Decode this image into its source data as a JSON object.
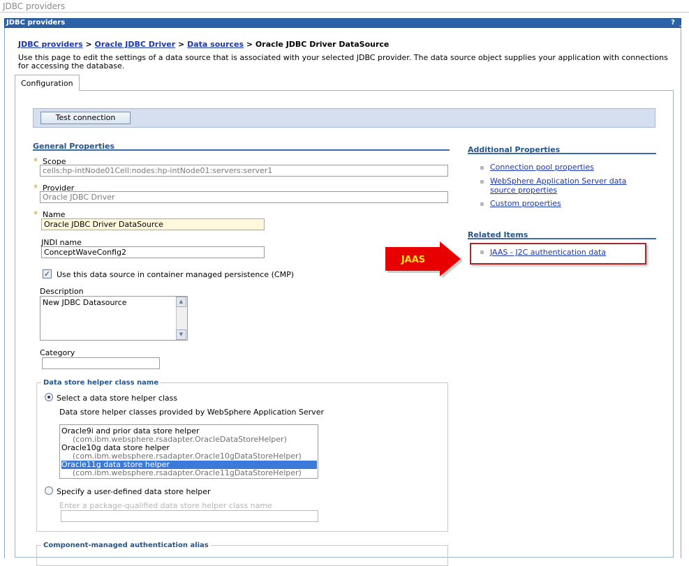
{
  "page": {
    "top_title": "JDBC providers",
    "portlet_title": "JDBC providers",
    "help_button": "?",
    "minimize_button": "_"
  },
  "breadcrumb": {
    "link1": "JDBC providers",
    "sep1": " > ",
    "link2": "Oracle JDBC Driver",
    "sep2": " > ",
    "link3": "Data sources",
    "sep3": " > ",
    "current": "Oracle JDBC Driver DataSource"
  },
  "description": "Use this page to edit the settings of a data source that is associated with your selected JDBC provider. The data source object supplies your application with connections for accessing the database.",
  "tabs": {
    "configuration": "Configuration"
  },
  "buttons": {
    "test_connection": "Test connection"
  },
  "general": {
    "heading": "General Properties",
    "required_mark": "*",
    "scope_label": "Scope",
    "scope_value": "cells:hp-intNode01Cell:nodes:hp-intNode01:servers:server1",
    "provider_label": "Provider",
    "provider_value": "Oracle JDBC Driver",
    "name_label": "Name",
    "name_value": "Oracle JDBC Driver DataSource",
    "jndi_label": "JNDI name",
    "jndi_value": "ConceptWaveConfig2",
    "cmp_label": "Use this data source in container managed persistence (CMP)",
    "cmp_checked": true,
    "description_label": "Description",
    "description_value": "New JDBC Datasource",
    "category_label": "Category",
    "category_value": ""
  },
  "helper": {
    "legend": "Data store helper class name",
    "select_label": "Select a data store helper class",
    "provided_label": "Data store helper classes provided by WebSphere Application Server",
    "options": [
      {
        "name": "Oracle9i and prior data store helper",
        "pkg": "(com.ibm.websphere.rsadapter.OracleDataStoreHelper)",
        "selected": false
      },
      {
        "name": "Oracle10g data store helper",
        "pkg": "(com.ibm.websphere.rsadapter.Oracle10gDataStoreHelper)",
        "selected": false
      },
      {
        "name": "Oracle11g data store helper",
        "pkg": "(com.ibm.websphere.rsadapter.Oracle11gDataStoreHelper)",
        "selected": true
      }
    ],
    "specify_label": "Specify a user-defined data store helper",
    "class_placeholder": "Enter a package-qualified data store helper class name"
  },
  "auth": {
    "legend": "Component-managed authentication alias"
  },
  "additional": {
    "heading": "Additional Properties",
    "connection_pool": "Connection pool properties",
    "was_ds_line1": "WebSphere Application Server data",
    "was_ds_line2": "source properties",
    "custom": "Custom properties"
  },
  "related": {
    "heading": "Related Items",
    "jaas_link": "JAAS - J2C authentication data"
  },
  "annotation": {
    "arrow_text": "JAAS",
    "arrow_color": "#e80000"
  }
}
